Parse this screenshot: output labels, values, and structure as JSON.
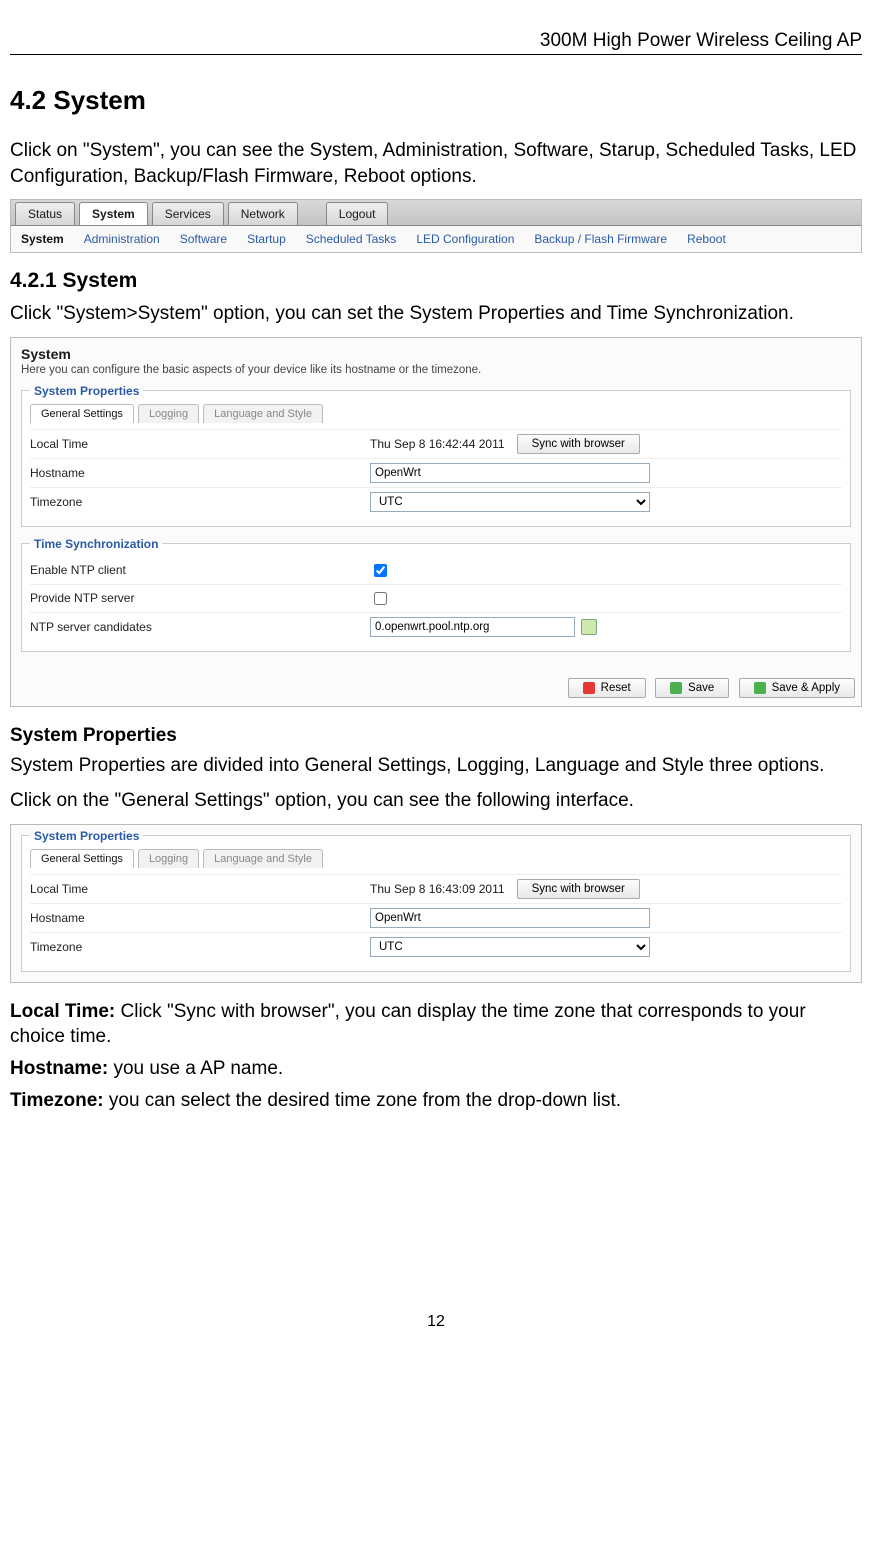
{
  "header": {
    "product": "300M High Power Wireless Ceiling AP"
  },
  "sec": {
    "h1": "4.2 System",
    "intro": "Click on \"System\", you can see the System, Administration, Software, Starup, Scheduled Tasks, LED Configuration, Backup/Flash Firmware, Reboot options.",
    "h2": "4.2.1 System",
    "sub_intro": "Click \"System>System\" option, you can set the System Properties and Time Synchronization.",
    "sp_title": "System Properties",
    "sp_desc": "System Properties are divided into General Settings, Logging, Language and Style three options.",
    "sp_click": "Click on the \"General Settings\" option, you can see the following interface.",
    "localtime_label": "Local Time:",
    "localtime_text": " Click \"Sync with browser\", you can display the time zone that corresponds to your choice time.",
    "hostname_label": "Hostname:",
    "hostname_text": " you use a AP name.",
    "timezone_label": "Timezone:",
    "timezone_text": " you can select the desired time zone from the drop-down list."
  },
  "tabs1": [
    "Status",
    "System",
    "Services",
    "Network",
    "Logout"
  ],
  "tabs2": [
    "System",
    "Administration",
    "Software",
    "Startup",
    "Scheduled Tasks",
    "LED Configuration",
    "Backup / Flash Firmware",
    "Reboot"
  ],
  "panel": {
    "title": "System",
    "desc": "Here you can configure the basic aspects of your device like its hostname or the timezone.",
    "sysprops_legend": "System Properties",
    "minitabs": [
      "General Settings",
      "Logging",
      "Language and Style"
    ],
    "rows": {
      "localtime": {
        "label": "Local Time",
        "value": "Thu Sep 8 16:42:44 2011",
        "btn": "Sync with browser"
      },
      "hostname": {
        "label": "Hostname",
        "value": "OpenWrt"
      },
      "timezone": {
        "label": "Timezone",
        "value": "UTC"
      }
    },
    "timesync_legend": "Time Synchronization",
    "ts_rows": {
      "enable": {
        "label": "Enable NTP client",
        "checked": true
      },
      "provide": {
        "label": "Provide NTP server",
        "checked": false
      },
      "candidates": {
        "label": "NTP server candidates",
        "value": "0.openwrt.pool.ntp.org"
      }
    },
    "buttons": {
      "reset": "Reset",
      "save": "Save",
      "saveapply": "Save & Apply"
    }
  },
  "panel2_time": "Thu Sep 8 16:43:09 2011",
  "page_number": "12"
}
